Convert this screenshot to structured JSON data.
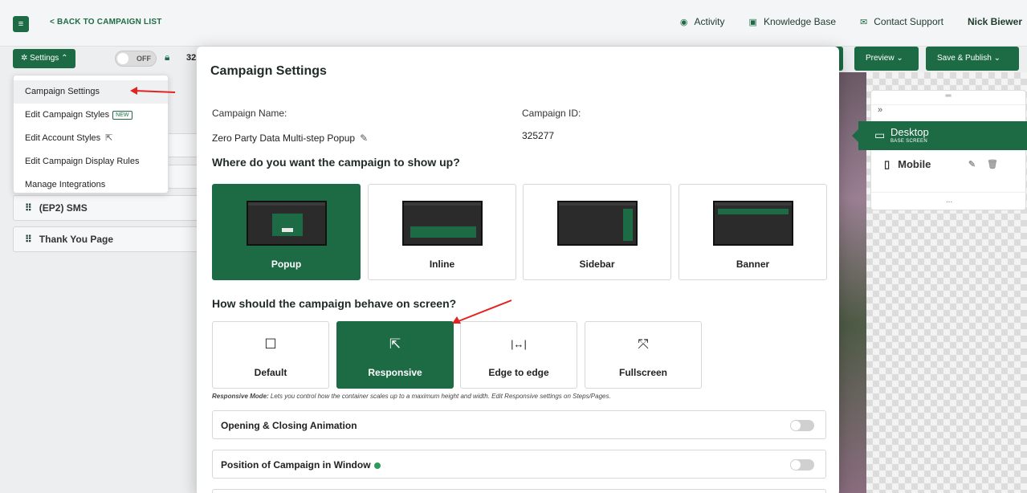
{
  "topbar": {
    "back_label": "< BACK TO CAMPAIGN LIST",
    "nav": [
      {
        "icon": "activity-icon",
        "label": "Activity"
      },
      {
        "icon": "book-icon",
        "label": "Knowledge Base"
      },
      {
        "icon": "support-icon",
        "label": "Contact Support"
      }
    ],
    "user": "Nick Biewer"
  },
  "toolbar": {
    "settings_label": "Settings",
    "toggle_label": "OFF",
    "campaign_id_partial": "32",
    "preview_label": "Preview",
    "save_label": "Save & Publish"
  },
  "dropdown": {
    "items": [
      {
        "label": "Campaign Settings"
      },
      {
        "label": "Edit Campaign Styles",
        "badge": "NEW"
      },
      {
        "label": "Edit Account Styles"
      },
      {
        "label": "Edit Campaign Display Rules"
      },
      {
        "label": "Manage Integrations"
      }
    ]
  },
  "steps": [
    {
      "label": "(EP2) SMS"
    },
    {
      "label": "Thank You Page"
    }
  ],
  "devices": {
    "desktop_label": "Desktop",
    "desktop_sub": "BASE SCREEN",
    "mobile_label": "Mobile",
    "more": "..."
  },
  "modal": {
    "title": "Campaign Settings",
    "name_label": "Campaign Name:",
    "name_value": "Zero Party Data Multi-step Popup",
    "id_label": "Campaign ID:",
    "id_value": "325277",
    "where_heading": "Where do you want the campaign to show up?",
    "placements": [
      {
        "label": "Popup",
        "selected": true
      },
      {
        "label": "Inline",
        "selected": false
      },
      {
        "label": "Sidebar",
        "selected": false
      },
      {
        "label": "Banner",
        "selected": false
      }
    ],
    "behave_heading": "How should the campaign behave on screen?",
    "behaviors": [
      {
        "label": "Default",
        "icon": "square-icon",
        "selected": false
      },
      {
        "label": "Responsive",
        "icon": "external-link-icon",
        "selected": true
      },
      {
        "label": "Edge to edge",
        "icon": "horizontal-expand-icon",
        "selected": false
      },
      {
        "label": "Fullscreen",
        "icon": "fullscreen-icon",
        "selected": false
      }
    ],
    "responsive_note_bold": "Responsive Mode:",
    "responsive_note": " Lets you control how the container scales up to a maximum height and width. Edit Responsive settings on Steps/Pages.",
    "rows": [
      {
        "label": "Opening & Closing Animation"
      },
      {
        "label": "Position of Campaign in Window"
      }
    ]
  },
  "colors": {
    "brand_green": "#1d6b45",
    "arrow_red": "#e32222"
  }
}
